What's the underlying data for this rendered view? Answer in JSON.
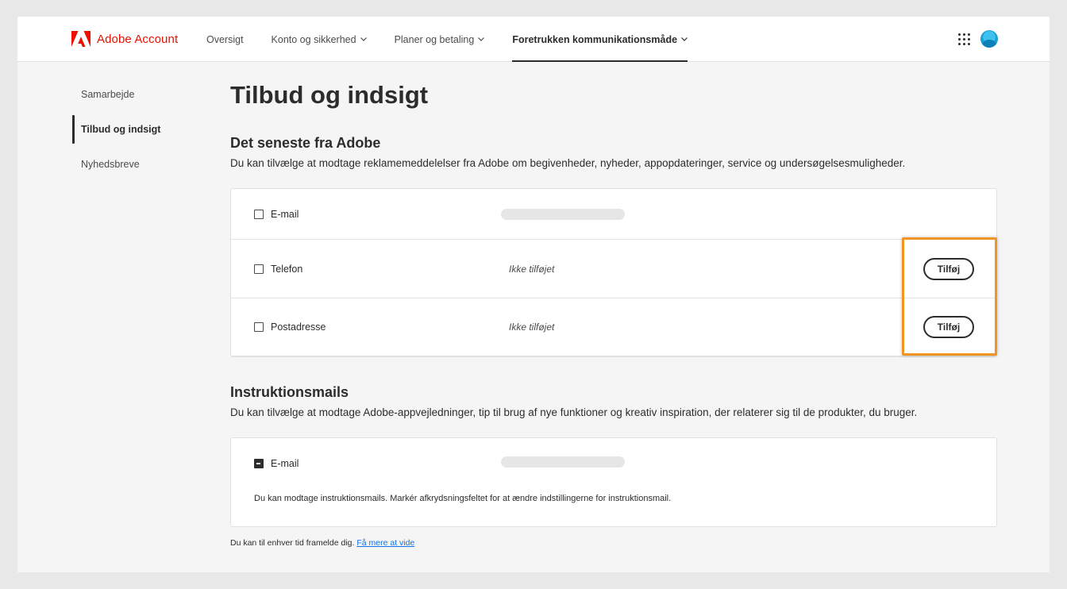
{
  "header": {
    "brand": "Adobe Account",
    "brand_color": "#eb1000",
    "nav": [
      {
        "label": "Oversigt",
        "has_dropdown": false,
        "active": false
      },
      {
        "label": "Konto og sikkerhed",
        "has_dropdown": true,
        "active": false
      },
      {
        "label": "Planer og betaling",
        "has_dropdown": true,
        "active": false
      },
      {
        "label": "Foretrukken kommunikationsmåde",
        "has_dropdown": true,
        "active": true
      }
    ],
    "apps_icon": "grid-apps-icon",
    "avatar_icon": "user-avatar"
  },
  "sidebar": {
    "items": [
      {
        "label": "Samarbejde",
        "active": false
      },
      {
        "label": "Tilbud og indsigt",
        "active": true
      },
      {
        "label": "Nyhedsbreve",
        "active": false
      }
    ]
  },
  "main": {
    "title": "Tilbud og indsigt",
    "latest": {
      "title": "Det seneste fra Adobe",
      "description": "Du kan tilvælge at modtage reklamemeddelelser fra Adobe om begivenheder, nyheder, appopdateringer, service og undersøgelsesmuligheder.",
      "rows": [
        {
          "label": "E-mail",
          "checked": false,
          "value_hidden": true
        },
        {
          "label": "Telefon",
          "checked": false,
          "status": "Ikke tilføjet",
          "button": "Tilføj"
        },
        {
          "label": "Postadresse",
          "checked": false,
          "status": "Ikke tilføjet",
          "button": "Tilføj"
        }
      ],
      "highlight_color": "#f29423"
    },
    "instructions": {
      "title": "Instruktionsmails",
      "description": "Du kan tilvælge at modtage Adobe-appvejledninger, tip til brug af nye funktioner og kreativ inspiration, der relaterer sig til de produkter, du bruger.",
      "row": {
        "label": "E-mail",
        "checked": "mixed",
        "value_hidden": true
      },
      "note": "Du kan modtage instruktionsmails. Markér afkrydsningsfeltet for at ændre indstillingerne for instruktionsmail."
    },
    "footer": {
      "text": "Du kan til enhver tid framelde dig.",
      "link": "Få mere at vide",
      "link_color": "#1473e6"
    }
  }
}
